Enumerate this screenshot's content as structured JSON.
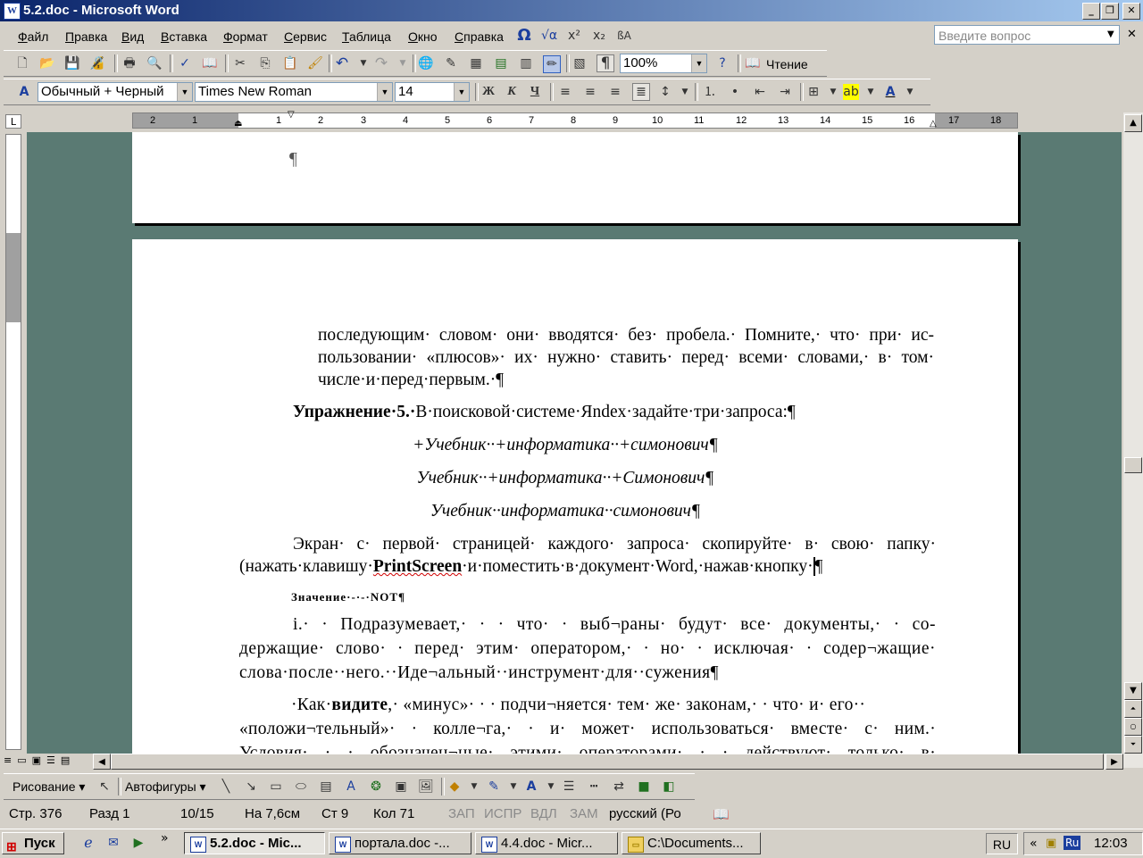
{
  "window": {
    "title": "5.2.doc - Microsoft Word",
    "app_icon": "W"
  },
  "menu": [
    "Файл",
    "Правка",
    "Вид",
    "Вставка",
    "Формат",
    "Сервис",
    "Таблица",
    "Окно",
    "Справка"
  ],
  "ask_placeholder": "Введите вопрос",
  "toolbar": {
    "zoom": "100%",
    "reading": "Чтение"
  },
  "format_toolbar": {
    "style": "Обычный + Черный",
    "font": "Times New Roman",
    "size": "14",
    "bold": "Ж",
    "italic": "К",
    "underline": "Ч"
  },
  "ruler_numbers": [
    "2",
    "1",
    "1",
    "2",
    "3",
    "4",
    "5",
    "6",
    "7",
    "8",
    "9",
    "10",
    "11",
    "12",
    "13",
    "14",
    "15",
    "16",
    "17",
    "18"
  ],
  "document": {
    "page1_mark": "¶",
    "para1": [
      "последующим· словом· они· вводятся· без· пробела.· Помните,· что· при· ис-",
      "пользовании· «плюсов»· их· нужно· ставить· перед· всеми· словами,· в· том·",
      "числе·и·перед·первым.·¶"
    ],
    "ex_bold": "Упражнение·5.·",
    "ex_text": "В·поисковой·системе·Яndex·задайте·три·запроса:¶",
    "query1": "+Учебник··+информатика··+симонович¶",
    "query2": "Учебник··+информатика··+Симонович¶",
    "query3": "Учебник··информатика··симонович¶",
    "para2_line1": "Экран· с· первой· страницей· каждого· запроса· скопируйте· в· свою· папку·",
    "para2_line2a": "(нажать·клавишу·",
    "para2_bold": "PrintScreen",
    "para2_line2b": "·и·поместить·в·документ·Word,·нажав·кнопку·",
    "para2_end": "¶",
    "small_line": "Значение·-·-·NOT¶",
    "para3": [
      "і.· · Подразумевает,· · · что· · выб¬раны· будут· все· документы,· · со-",
      "держащие· слово· · перед· этим· оператором,· · но· · исключая· · содер¬жащие·",
      "слова·после··него.··Иде¬альный··инструмент·для··сужения¶"
    ],
    "para4_a": "·Как·",
    "para4_bold": "видите",
    "para4_b": ",· «минус»· · · подчи¬няется· тем· же· законам,· · что· и· его··",
    "para4_line2": "«положи¬тельный»· · колле¬га,· · и· может· использоваться· вместе· с· ним.·",
    "para4_line3": "Условия· · · обозначен¬ные· этими· операторами· · · действуют· только· в·"
  },
  "drawing_toolbar": {
    "draw": "Рисование",
    "autoshapes": "Автофигуры"
  },
  "status": {
    "page": "Стр. 376",
    "section": "Разд 1",
    "pages": "10/15",
    "at": "На 7,6см",
    "line": "Ст 9",
    "col": "Кол 71",
    "rec": "ЗАП",
    "trk": "ИСПР",
    "ext": "ВДЛ",
    "ovr": "ЗАМ",
    "lang": "русский (Ро"
  },
  "taskbar": {
    "start": "Пуск",
    "tasks": [
      "5.2.doc - Mic...",
      "портала.doc -...",
      "4.4.doc - Micr...",
      "C:\\Documents..."
    ],
    "lang": "RU",
    "tray_lang": "Ru",
    "clock": "12:03",
    "chevron": "»",
    "tray_chevron": "«"
  }
}
